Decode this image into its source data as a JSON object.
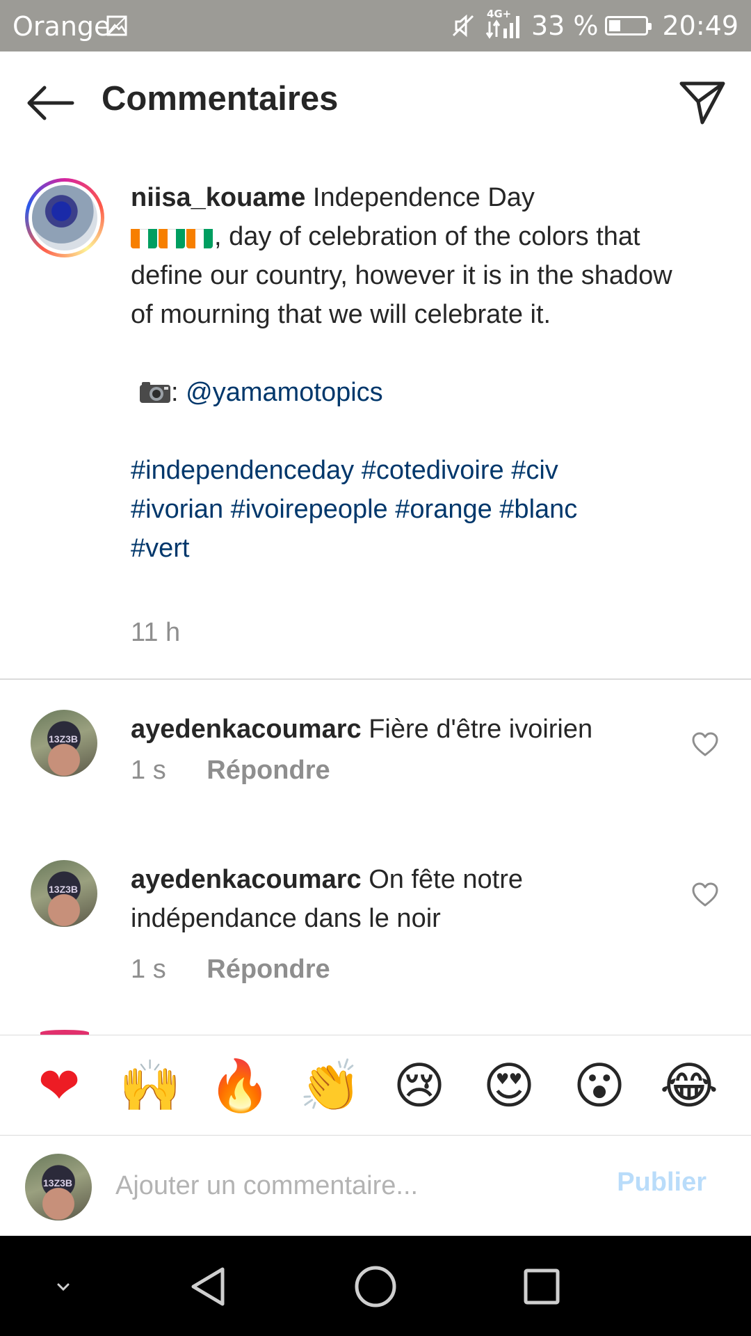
{
  "status_bar": {
    "carrier": "Orange",
    "network": "4G+",
    "battery": "33 %",
    "time": "20:49"
  },
  "header": {
    "title": "Commentaires"
  },
  "caption": {
    "username": "niisa_kouame",
    "text_before_flags": "Independence Day",
    "text_after_flags": ", day of celebration of the colors that define our country, however it is in the shadow of mourning that we will celebrate it.",
    "camera_suffix": ":",
    "mention": "@yamamotopics",
    "hashtags": [
      "#independenceday",
      "#cotedivoire",
      "#civ",
      "#ivorian",
      "#ivoirepeople",
      "#orange",
      "#blanc",
      "#vert"
    ],
    "time": "11 h",
    "flag_colors": [
      "#f77f00",
      "#ffffff",
      "#009e60"
    ]
  },
  "comments": [
    {
      "username": "ayedenkacoumarc",
      "text": "Fière d'être ivoirien",
      "time": "1 s",
      "reply_label": "Répondre"
    },
    {
      "username": "ayedenkacoumarc",
      "text": "On fête notre indépendance dans le noir",
      "time": "1 s",
      "reply_label": "Répondre"
    }
  ],
  "emoji_bar": [
    {
      "glyph": "❤",
      "name": "red-heart"
    },
    {
      "glyph": "🙌",
      "name": "raising-hands"
    },
    {
      "glyph": "🔥",
      "name": "fire"
    },
    {
      "glyph": "👏",
      "name": "clapping-hands"
    },
    {
      "glyph": "😢",
      "name": "crying-face"
    },
    {
      "glyph": "😍",
      "name": "heart-eyes"
    },
    {
      "glyph": "😮",
      "name": "open-mouth"
    },
    {
      "glyph": "😂",
      "name": "tears-of-joy"
    }
  ],
  "comment_input": {
    "placeholder": "Ajouter un commentaire...",
    "value": "",
    "publish_label": "Publier"
  },
  "colors": {
    "link": "#00376b",
    "muted": "#8e8e8e",
    "publish_disabled": "#b9dcfa",
    "status_bar": "#9c9b96"
  }
}
